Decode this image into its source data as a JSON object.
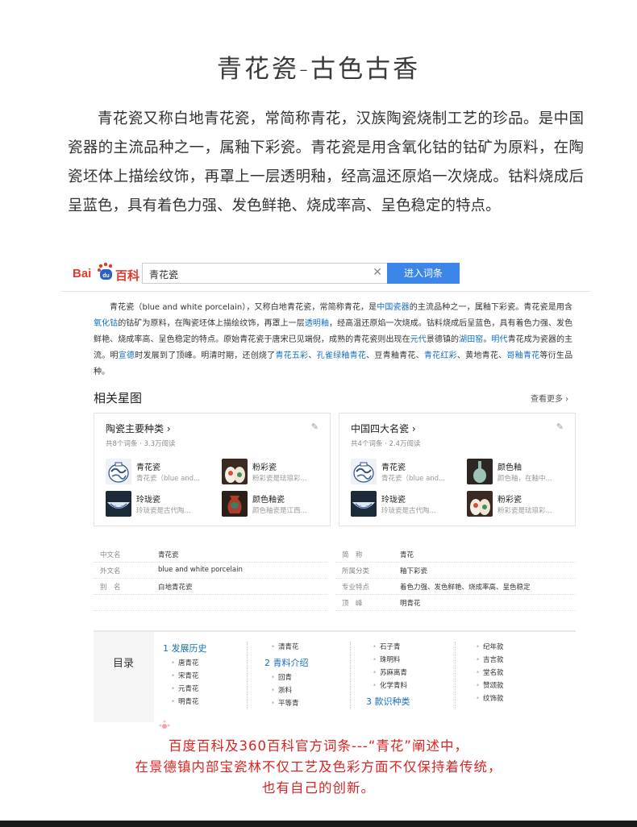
{
  "page": {
    "title": "青花瓷-古色古香",
    "intro": "青花瓷又称白地青花瓷，常简称青花，汉族陶瓷烧制工艺的珍品。是中国瓷器的主流品种之一，属釉下彩瓷。青花瓷是用含氧化钴的钴矿为原料，在陶瓷坯体上描绘纹饰，再罩上一层透明釉，经高温还原焰一次烧成。钴料烧成后呈蓝色，具有着色力强、发色鲜艳、烧成率高、呈色稳定的特点。",
    "caption_line1": "百度百科及360百科官方词条---“青花”阐述中，",
    "caption_line2": "在景德镇内部宝瓷林不仅工艺及色彩方面不仅保持着传统，",
    "caption_line3": "也有自己的创新。"
  },
  "baike": {
    "logo_bai": "Bai",
    "logo_du": "du",
    "logo_baike": "百科",
    "search_value": "青花瓷",
    "search_button": "进入词条",
    "body": {
      "p1": "青花瓷（blue and white porcelain），又称白地青花瓷，常简称青花，是",
      "l1": "中国瓷器",
      "p2": "的主流品种之一，属釉下彩瓷。青花瓷是用含",
      "l2": "氧化钴",
      "p3": "的钴矿为原料，在陶瓷坯体上描绘纹饰，再罩上一层",
      "l3": "透明釉",
      "p4": "，经高温还原焰一次烧成。钴料烧成后呈蓝色，具有着色力强、发色鲜艳、烧成率高、呈色稳定的特点。原始青花瓷于唐宋已见端倪，成熟的青花瓷则出现在",
      "l4": "元代",
      "p5": "景德镇的",
      "l5": "湖田窑",
      "p6": "。",
      "l6": "明代",
      "p7": "青花成为瓷器的主流。明",
      "l7": "宣德",
      "p8": "时发展到了顶峰。明清时期，还创烧了",
      "l8": "青花五彩",
      "p9": "、",
      "l9": "孔雀绿釉青花",
      "p10": "、豆青釉青花、",
      "l10": "青花红彩",
      "p11": "、黄地青花、",
      "l11": "哥釉青花",
      "p12": "等衍生品种。"
    },
    "related": {
      "title": "相关星图",
      "more": "查看更多 ›",
      "cards": [
        {
          "title": "陶瓷主要种类 ›",
          "meta": "共8个词条 · 3.3万阅读",
          "items": [
            {
              "name": "青花瓷",
              "desc": "青花瓷（blue and..."
            },
            {
              "name": "粉彩瓷",
              "desc": "粉彩瓷是珐琅彩..."
            },
            {
              "name": "玲珑瓷",
              "desc": "玲珑瓷是古代陶..."
            },
            {
              "name": "颜色釉瓷",
              "desc": "颜色釉瓷是江西..."
            }
          ]
        },
        {
          "title": "中国四大名瓷 ›",
          "meta": "共4个词条 · 2.4万阅读",
          "items": [
            {
              "name": "青花瓷",
              "desc": "青花瓷（blue and..."
            },
            {
              "name": "颜色釉",
              "desc": "颜色釉，在釉中..."
            },
            {
              "name": "玲珑瓷",
              "desc": "玲珑瓷是古代陶..."
            },
            {
              "name": "粉彩瓷",
              "desc": "粉彩瓷是珐琅彩..."
            }
          ]
        }
      ]
    },
    "info": {
      "left": [
        {
          "k": "中文名",
          "v": "青花瓷"
        },
        {
          "k": "外文名",
          "v": "blue and white porcelain"
        },
        {
          "k": "别　名",
          "v": "白地青花瓷"
        }
      ],
      "right": [
        {
          "k": "简　称",
          "v": "青花"
        },
        {
          "k": "所属分类",
          "v": "釉下彩瓷"
        },
        {
          "k": "专业特点",
          "v": "着色力强、发色鲜艳、烧成率高、呈色稳定"
        },
        {
          "k": "顶　峰",
          "v": "明青花"
        }
      ]
    },
    "toc": {
      "label": "目录",
      "h1": "1  发展历史",
      "h1_items": [
        "唐青花",
        "宋青花",
        "元青花",
        "明青花"
      ],
      "col2_top": "清青花",
      "h2": "2  青料介绍",
      "h2_items": [
        "回青",
        "浙料",
        "平等青"
      ],
      "col3_items": [
        "石子青",
        "珠明料",
        "苏麻离青",
        "化学青料"
      ],
      "h3": "3  款识种类",
      "col4_items": [
        "纪年款",
        "吉言款",
        "堂名款",
        "赞颂款",
        "纹饰款"
      ]
    }
  },
  "colors": {
    "caption": "#d92424",
    "link": "#136ec2",
    "button": "#3c86e8",
    "logo": "#de3b31"
  }
}
